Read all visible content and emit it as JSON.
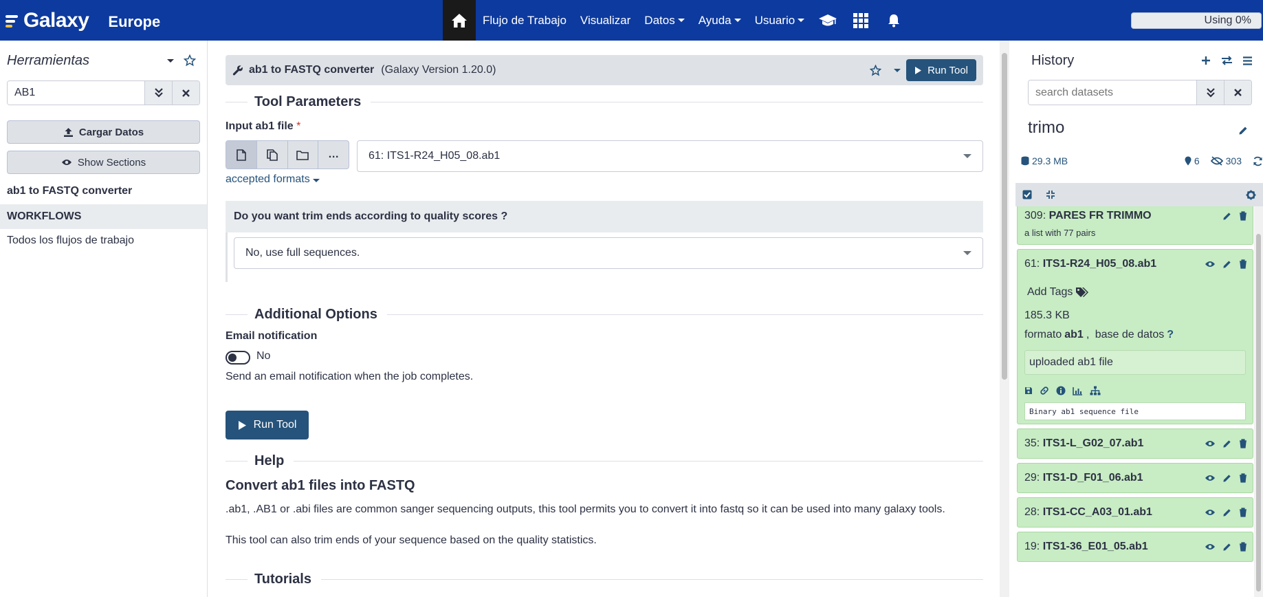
{
  "masthead": {
    "brand": "Galaxy",
    "brand_sub": "Europe",
    "nav": [
      {
        "label": "Flujo de Trabajo",
        "dropdown": false
      },
      {
        "label": "Visualizar",
        "dropdown": false
      },
      {
        "label": "Datos",
        "dropdown": true
      },
      {
        "label": "Ayuda",
        "dropdown": true
      },
      {
        "label": "Usuario",
        "dropdown": true
      }
    ],
    "quota": "Using 0%",
    "colors": {
      "bar": "#0d3a9e",
      "home": "#1a1a1a"
    }
  },
  "left": {
    "title": "Herramientas",
    "search_value": "AB1",
    "upload_label": "Cargar Datos",
    "sections_label": "Show Sections",
    "result_tool": "ab1 to FASTQ converter",
    "section_header": "WORKFLOWS",
    "workflow_link": "Todos los flujos de trabajo"
  },
  "tool": {
    "name": "ab1 to FASTQ converter",
    "version": "(Galaxy Version 1.20.0)",
    "run_label": "Run Tool",
    "params_title": "Tool Parameters",
    "input_label": "Input ab1 file",
    "required_mark": "*",
    "input_value": "61: ITS1-R24_H05_08.ab1",
    "accepted_formats": "accepted formats",
    "trim_question": "Do you want trim ends according to quality scores ?",
    "trim_value": "No, use full sequences.",
    "additional_title": "Additional Options",
    "email_label": "Email notification",
    "email_toggle": "No",
    "email_help": "Send an email notification when the job completes.",
    "help_section": "Help",
    "help_title": "Convert ab1 files into FASTQ",
    "help_p1": ".ab1, .AB1 or .abi files are common sanger sequencing outputs, this tool permits you to convert it into fastq so it can be used into many galaxy tools.",
    "help_p2": "This tool can also trim ends of your sequence based on the quality statistics.",
    "tutorials": "Tutorials",
    "accent": "#25537b"
  },
  "history": {
    "title": "History",
    "search_placeholder": "search datasets",
    "name": "trimo",
    "size": "29.3 MB",
    "pinned": "6",
    "hidden": "303",
    "datasets": [
      {
        "hid": "309:",
        "name": "PARES FR TRIMMO",
        "sub": "a list with 77 pairs"
      },
      {
        "hid": "61:",
        "name": "ITS1-R24_H05_08.ab1",
        "tags": "Add Tags",
        "size": "185.3 KB",
        "format_prefix": "formato",
        "format": "ab1",
        "db_prefix": "base de datos",
        "db": "?",
        "info": "uploaded ab1 file",
        "peek": "Binary ab1 sequence file"
      },
      {
        "hid": "35:",
        "name": "ITS1-L_G02_07.ab1"
      },
      {
        "hid": "29:",
        "name": "ITS1-D_F01_06.ab1"
      },
      {
        "hid": "28:",
        "name": "ITS1-CC_A03_01.ab1"
      },
      {
        "hid": "19:",
        "name": "ITS1-36_E01_05.ab1"
      }
    ],
    "ok_color": "#c8ecc4"
  }
}
